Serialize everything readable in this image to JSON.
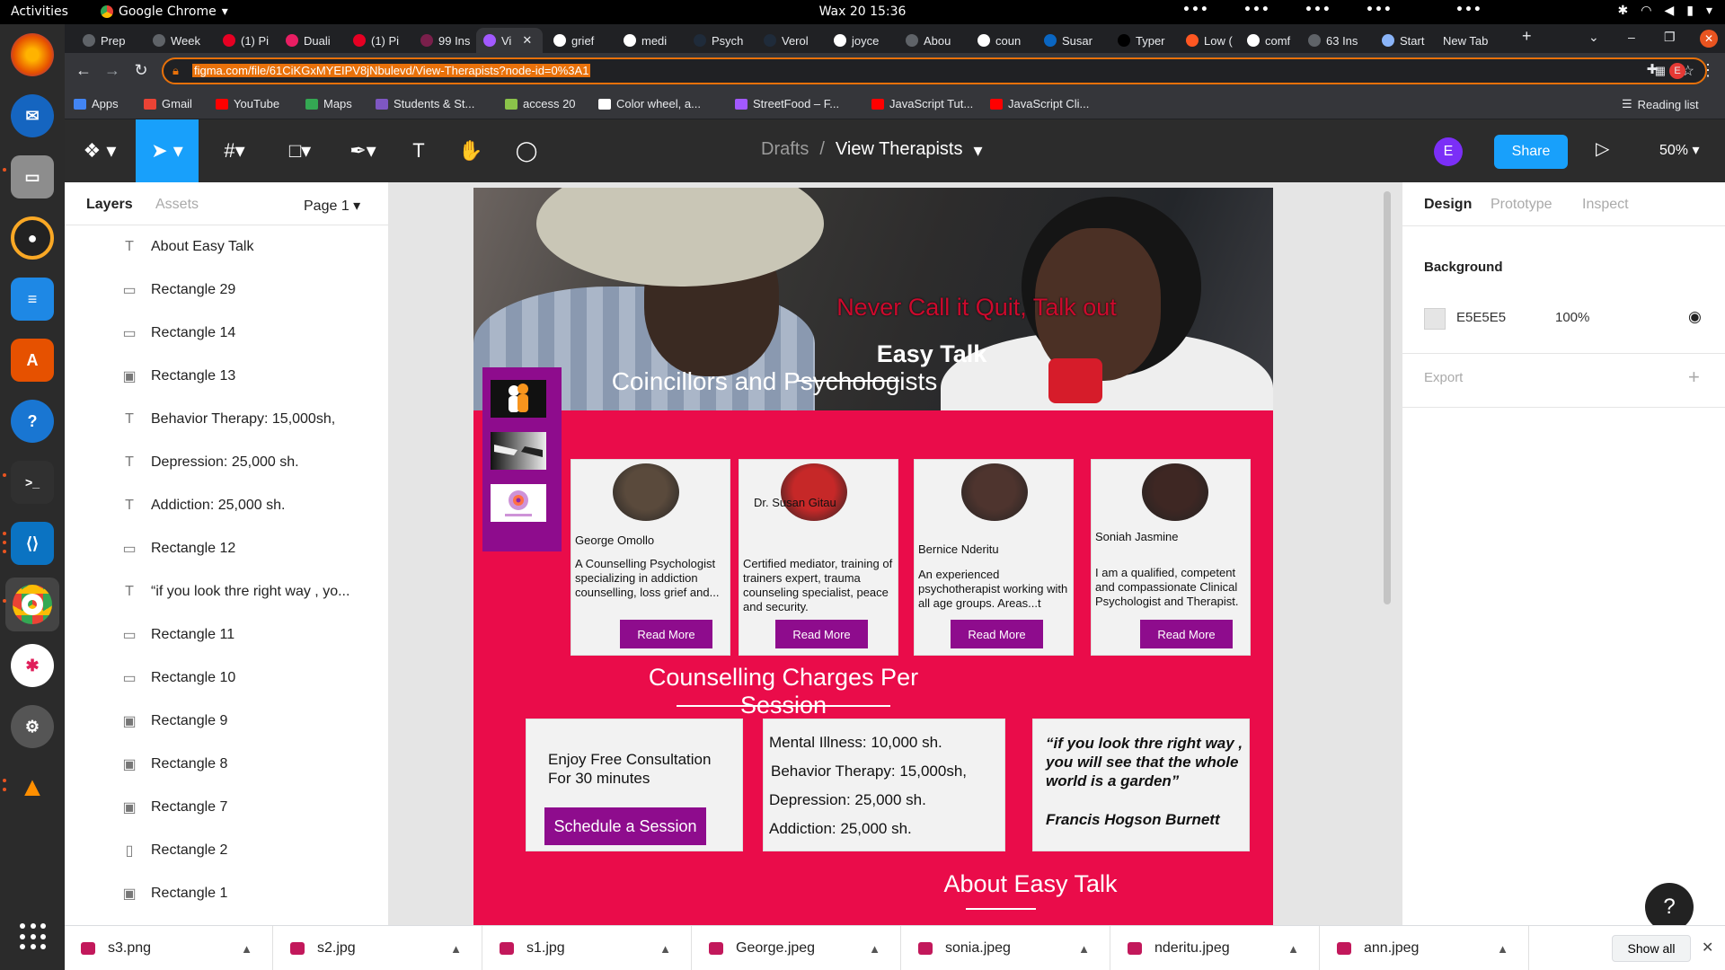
{
  "os": {
    "activities": "Activities",
    "app_name": "Google Chrome",
    "clock": "Wax 20  15:36"
  },
  "browser": {
    "tabs": [
      {
        "label": "Prep",
        "color": "#5f6368"
      },
      {
        "label": "Week",
        "color": "#5f6368"
      },
      {
        "label": "(1) Pi",
        "color": "#e60023"
      },
      {
        "label": "Duali",
        "color": "#e91e63"
      },
      {
        "label": "(1) Pi",
        "color": "#e60023"
      },
      {
        "label": "99 Ins",
        "color": "#7a1f4b"
      },
      {
        "label": "Vi",
        "color": "#a259ff",
        "active": true
      },
      {
        "label": "grief",
        "color": "#ffffff"
      },
      {
        "label": "medi",
        "color": "#ffffff"
      },
      {
        "label": "Psych",
        "color": "#1f2b3a"
      },
      {
        "label": "Verol",
        "color": "#1f2b3a"
      },
      {
        "label": "joyce",
        "color": "#ffffff"
      },
      {
        "label": "Abou",
        "color": "#5f6368"
      },
      {
        "label": "coun",
        "color": "#ffffff"
      },
      {
        "label": "Susar",
        "color": "#0a66c2"
      },
      {
        "label": "Typer",
        "color": "#000000"
      },
      {
        "label": "Low (",
        "color": "#ff5722"
      },
      {
        "label": "comf",
        "color": "#ffffff"
      },
      {
        "label": "63 Ins",
        "color": "#5f6368"
      },
      {
        "label": "Start",
        "color": "#8ab4f8"
      },
      {
        "label": "New Tab",
        "color": ""
      }
    ],
    "url": "figma.com/file/61CiKGxMYEIPV8jNbulevd/View-Therapists?node-id=0%3A1",
    "bookmarks": [
      {
        "label": "Apps",
        "color": "#4285f4"
      },
      {
        "label": "Gmail",
        "color": "#ea4335"
      },
      {
        "label": "YouTube",
        "color": "#ff0000"
      },
      {
        "label": "Maps",
        "color": "#34a853"
      },
      {
        "label": "Students & St...",
        "color": "#7e57c2"
      },
      {
        "label": "access 20",
        "color": "#8bc34a"
      },
      {
        "label": "Color wheel, a...",
        "color": "#ffffff"
      },
      {
        "label": "StreetFood – F...",
        "color": "#a259ff"
      },
      {
        "label": "JavaScript Tut...",
        "color": "#ff0000"
      },
      {
        "label": "JavaScript Cli...",
        "color": "#ff0000"
      }
    ],
    "reading_list": "Reading list"
  },
  "figma": {
    "breadcrumb_root": "Drafts",
    "breadcrumb_sep": "/",
    "file_name": "View Therapists",
    "avatar_letter": "E",
    "share_label": "Share",
    "zoom": "50%",
    "left_panel": {
      "tab_layers": "Layers",
      "tab_assets": "Assets",
      "page": "Page 1",
      "layers": [
        {
          "icon": "T",
          "name": "About Easy Talk"
        },
        {
          "icon": "▭",
          "name": "Rectangle 29"
        },
        {
          "icon": "▭",
          "name": "Rectangle 14"
        },
        {
          "icon": "▣",
          "name": "Rectangle 13"
        },
        {
          "icon": "T",
          "name": "Behavior Therapy: 15,000sh,"
        },
        {
          "icon": "T",
          "name": "Depression: 25,000 sh."
        },
        {
          "icon": "T",
          "name": "Addiction: 25,000 sh."
        },
        {
          "icon": "▭",
          "name": "Rectangle 12"
        },
        {
          "icon": "T",
          "name": "“if you look thre right way , yo..."
        },
        {
          "icon": "▭",
          "name": "Rectangle 11"
        },
        {
          "icon": "▭",
          "name": "Rectangle 10"
        },
        {
          "icon": "▣",
          "name": "Rectangle 9"
        },
        {
          "icon": "▣",
          "name": "Rectangle 8"
        },
        {
          "icon": "▣",
          "name": "Rectangle 7"
        },
        {
          "icon": "▯",
          "name": "Rectangle 2"
        },
        {
          "icon": "▣",
          "name": "Rectangle 1"
        }
      ]
    },
    "design": {
      "hero_slogan": "Never Call it Quit, Talk out",
      "hero_title": "Easy Talk",
      "section_counsellors": "Coincillors and Psychologists",
      "section_charges": "Counselling Charges Per Session",
      "section_about": "About Easy Talk",
      "read_more": "Read More",
      "therapists": [
        {
          "name": "George Omollo",
          "desc": "A Counselling Psychologist specializing in addiction counselling, loss grief and...",
          "photo_color": "#5a4a3c"
        },
        {
          "name": "Dr. Susan Gitau",
          "desc": "Certified mediator, training of trainers expert, trauma counseling specialist, peace and security.",
          "photo_color": "#c62828"
        },
        {
          "name": "Bernice Nderitu",
          "desc": "An experienced psychotherapist working with all age groups. Areas...t",
          "photo_color": "#4e342e"
        },
        {
          "name": "Soniah Jasmine",
          "desc": "I am a qualified, competent and compassionate Clinical Psychologist and Therapist.",
          "photo_color": "#3e2723"
        }
      ],
      "consult_line1": "Enjoy Free Consultation",
      "consult_line2": "For 30 minutes",
      "schedule_label": "Schedule a Session",
      "prices": [
        "Mental Illness: 10,000 sh.",
        "Behavior Therapy: 15,000sh,",
        "Depression: 25,000 sh.",
        "Addiction: 25,000 sh."
      ],
      "quote": "“if you look thre right way , you will see that the whole world is a garden”",
      "quote_author": "Francis Hogson Burnett"
    },
    "right_panel": {
      "tab_design": "Design",
      "tab_prototype": "Prototype",
      "tab_inspect": "Inspect",
      "background_label": "Background",
      "background_hex": "E5E5E5",
      "background_opacity": "100%",
      "export_label": "Export"
    },
    "help": "?"
  },
  "downloads": {
    "items": [
      "s3.png",
      "s2.jpg",
      "s1.jpg",
      "George.jpeg",
      "sonia.jpeg",
      "nderitu.jpeg",
      "ann.jpeg"
    ],
    "show_all": "Show all"
  }
}
